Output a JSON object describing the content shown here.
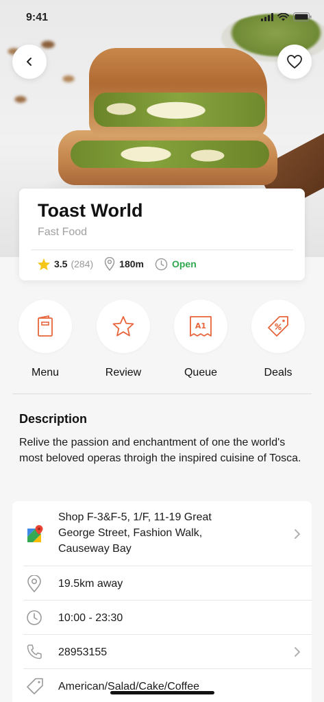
{
  "status_bar": {
    "time": "9:41"
  },
  "hero": {
    "image_alt": "Grilled pesto cheese toast sandwich"
  },
  "restaurant": {
    "name": "Toast World",
    "category": "Fast Food",
    "rating": "3.5",
    "reviews": "(284)",
    "distance": "180m",
    "status": "Open"
  },
  "actions": [
    {
      "label": "Menu",
      "icon": "menu-book-icon"
    },
    {
      "label": "Review",
      "icon": "star-outline-icon"
    },
    {
      "label": "Queue",
      "icon": "queue-ticket-icon"
    },
    {
      "label": "Deals",
      "icon": "discount-tag-icon"
    }
  ],
  "queue_ticket_text": "A1",
  "description": {
    "title": "Description",
    "text": "Relive the passion and enchantment of one the world's most beloved operas throigh the inspired cuisine of Tosca."
  },
  "details": {
    "address": "Shop F-3&F-5, 1/F, 11-19 Great George Street, Fashion Walk, Causeway Bay",
    "away": "19.5km away",
    "hours": "10:00 - 23:30",
    "phone": "28953155",
    "tags": "American/Salad/Cake/Coffee"
  },
  "colors": {
    "accent": "#e8643a",
    "open_green": "#2fa84f",
    "star_yellow": "#f5c518",
    "muted": "#a0a0a0"
  }
}
